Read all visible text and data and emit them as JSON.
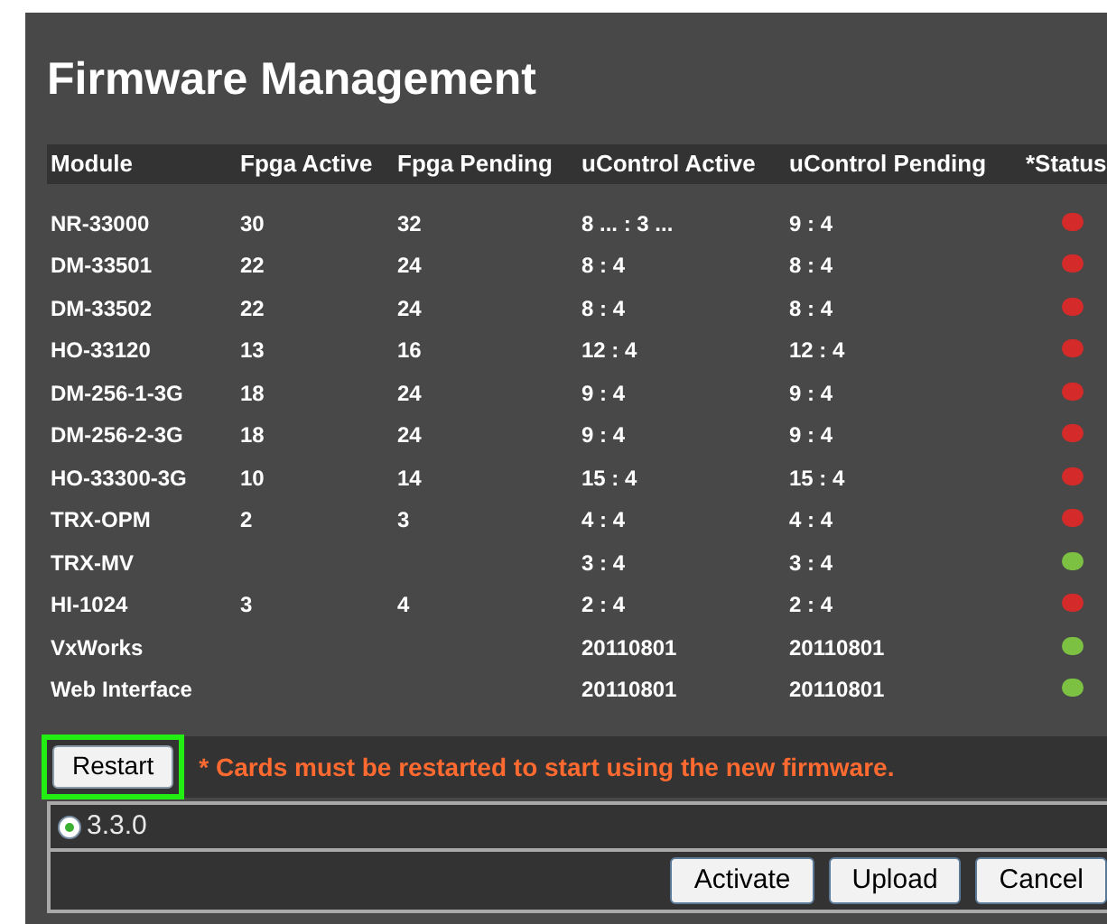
{
  "title": "Firmware Management",
  "table": {
    "columns": [
      "Module",
      "Fpga Active",
      "Fpga Pending",
      "uControl Active",
      "uControl Pending",
      "*Status"
    ],
    "rows": [
      {
        "module": "NR-33000",
        "fpga_active": "30",
        "fpga_pending": "32",
        "ucontrol_active": "8 ... : 3 ...",
        "ucontrol_pending": "9 : 4",
        "color": "#d42a2a"
      },
      {
        "module": "DM-33501",
        "fpga_active": "22",
        "fpga_pending": "24",
        "ucontrol_active": "8 : 4",
        "ucontrol_pending": "8 : 4",
        "color": "#d42a2a"
      },
      {
        "module": "DM-33502",
        "fpga_active": "22",
        "fpga_pending": "24",
        "ucontrol_active": "8 : 4",
        "ucontrol_pending": "8 : 4",
        "color": "#d42a2a"
      },
      {
        "module": "HO-33120",
        "fpga_active": "13",
        "fpga_pending": "16",
        "ucontrol_active": "12 : 4",
        "ucontrol_pending": "12 : 4",
        "color": "#d42a2a"
      },
      {
        "module": "DM-256-1-3G",
        "fpga_active": "18",
        "fpga_pending": "24",
        "ucontrol_active": "9 : 4",
        "ucontrol_pending": "9 : 4",
        "color": "#d42a2a"
      },
      {
        "module": "DM-256-2-3G",
        "fpga_active": "18",
        "fpga_pending": "24",
        "ucontrol_active": "9 : 4",
        "ucontrol_pending": "9 : 4",
        "color": "#d42a2a"
      },
      {
        "module": "HO-33300-3G",
        "fpga_active": "10",
        "fpga_pending": "14",
        "ucontrol_active": "15 : 4",
        "ucontrol_pending": "15 : 4",
        "color": "#d42a2a"
      },
      {
        "module": "TRX-OPM",
        "fpga_active": "2",
        "fpga_pending": "3",
        "ucontrol_active": "4 : 4",
        "ucontrol_pending": "4 : 4",
        "color": "#d42a2a"
      },
      {
        "module": "TRX-MV",
        "ucontrol_active": "3 : 4",
        "ucontrol_pending": "3 : 4",
        "color": "#7cc142"
      },
      {
        "module": "HI-1024",
        "fpga_active": "3",
        "fpga_pending": "4",
        "ucontrol_active": "2 : 4",
        "ucontrol_pending": "2 : 4",
        "color": "#d42a2a"
      },
      {
        "module": "VxWorks",
        "ucontrol_active": "20110801",
        "ucontrol_pending": "20110801",
        "color": "#7cc142"
      },
      {
        "module": "Web Interface",
        "ucontrol_active": "20110801",
        "ucontrol_pending": "20110801",
        "color": "#7cc142"
      }
    ]
  },
  "restart_button": "Restart",
  "restart_highlighted": true,
  "notice": "* Cards must be restarted to start using the new firmware.",
  "versions": [
    {
      "label": "3.3.0",
      "selected": true
    }
  ],
  "buttons": [
    "Activate",
    "Upload",
    "Cancel"
  ]
}
